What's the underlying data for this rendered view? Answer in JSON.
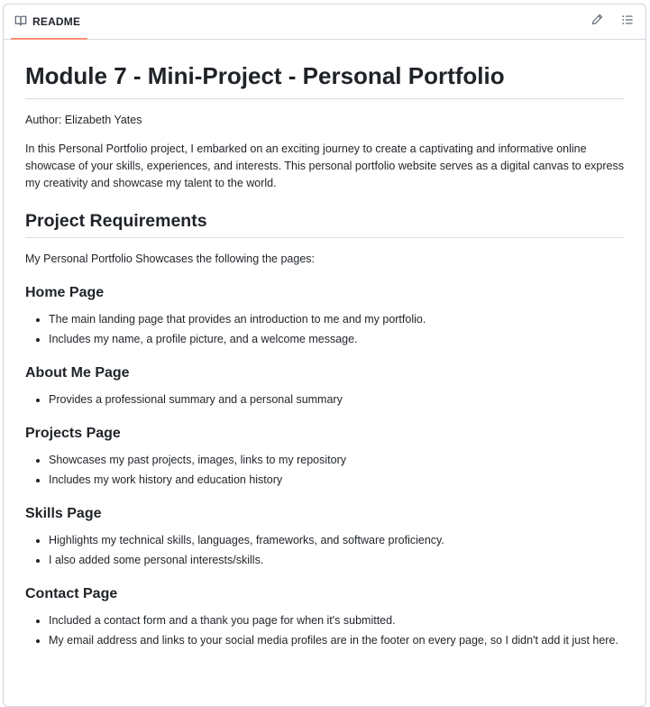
{
  "tab": {
    "label": "README",
    "icon": "book-icon"
  },
  "actions": {
    "edit_icon": "pencil-icon",
    "outline_icon": "list-icon"
  },
  "readme": {
    "title": "Module 7 - Mini-Project - Personal Portfolio",
    "author": "Author: Elizabeth Yates",
    "intro": "In this Personal Portfolio project, I embarked on an exciting journey to create a captivating and informative online showcase of your skills, experiences, and interests. This personal portfolio website serves as a digital canvas to express my creativity and showcase my talent to the world.",
    "req_heading": "Project Requirements",
    "req_text": "My Personal Portfolio Showcases the following the pages:",
    "sections": [
      {
        "heading": "Home Page",
        "items": [
          "The main landing page that provides an introduction to me and my portfolio.",
          "Includes my name, a profile picture, and a welcome message."
        ]
      },
      {
        "heading": "About Me Page",
        "items": [
          "Provides a professional summary and a personal summary"
        ]
      },
      {
        "heading": "Projects Page",
        "items": [
          "Showcases my past projects, images, links to my repository",
          "Includes my work history and education history"
        ]
      },
      {
        "heading": "Skills Page",
        "items": [
          "Highlights my technical skills, languages, frameworks, and software proficiency.",
          "I also added some personal interests/skills."
        ]
      },
      {
        "heading": "Contact Page",
        "items": [
          "Included a contact form and a thank you page for when it's submitted.",
          "My email address and links to your social media profiles are in the footer on every page, so I didn't add it just here."
        ]
      }
    ]
  }
}
